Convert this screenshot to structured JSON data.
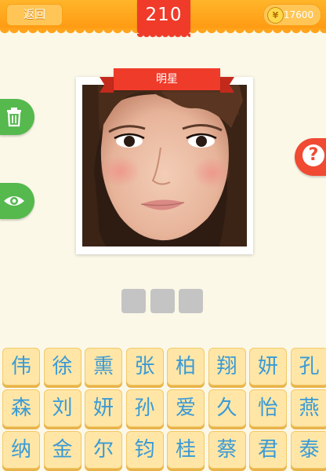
{
  "topbar": {
    "back_label": "返回",
    "level": "210",
    "coins": "17600",
    "coin_symbol": "¥"
  },
  "puzzle": {
    "category": "明星",
    "answer_slots": 3
  },
  "side_buttons": {
    "remove_icon": "trash-icon",
    "reveal_icon": "eye-icon",
    "hint_glyph": "?"
  },
  "grid": {
    "rows": [
      [
        "伟",
        "徐",
        "熏",
        "张",
        "柏",
        "翔",
        "妍",
        "孔"
      ],
      [
        "森",
        "刘",
        "妍",
        "孙",
        "爱",
        "久",
        "怡",
        "燕"
      ],
      [
        "纳",
        "金",
        "尔",
        "钧",
        "桂",
        "蔡",
        "君",
        "泰"
      ]
    ]
  },
  "colors": {
    "topbar": "#ffa41c",
    "level_tab": "#f03b2a",
    "green_button": "#55b94e",
    "hint_button": "#f04a33",
    "tile_bg": "#ffe6a6",
    "tile_text": "#3a9ad6",
    "background": "#fbf8e8"
  }
}
